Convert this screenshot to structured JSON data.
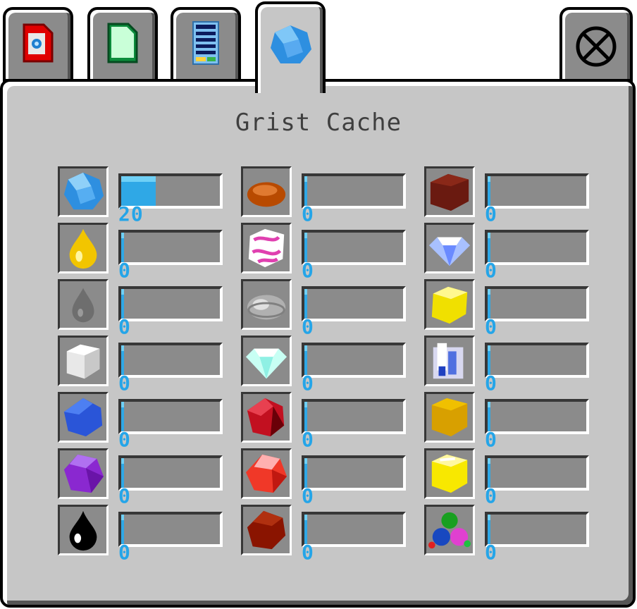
{
  "title": "Grist Cache",
  "tabs": [
    {
      "name": "captchalogue-tab",
      "icon": "red-document-icon"
    },
    {
      "name": "sylladex-tab",
      "icon": "green-document-icon"
    },
    {
      "name": "tower-tab",
      "icon": "building-icon"
    },
    {
      "name": "grist-cache-tab",
      "icon": "build-grist-icon",
      "active": true
    }
  ],
  "close_icon": "close-icon",
  "grist": [
    {
      "id": "build",
      "icon": "build-grist-icon",
      "amount": "20",
      "fill": 0.35
    },
    {
      "id": "amber",
      "icon": "amber-grist-icon",
      "amount": "0",
      "fill": 0
    },
    {
      "id": "artifact",
      "icon": "artifact-grist-icon",
      "amount": "0",
      "fill": 0
    },
    {
      "id": "chalk",
      "icon": "chalk-grist-icon",
      "amount": "0",
      "fill": 0
    },
    {
      "id": "cobalt",
      "icon": "cobalt-grist-icon",
      "amount": "0",
      "fill": 0
    },
    {
      "id": "amethyst",
      "icon": "amethyst-grist-icon",
      "amount": "0",
      "fill": 0
    },
    {
      "id": "tar",
      "icon": "tar-grist-icon",
      "amount": "0",
      "fill": 0
    },
    {
      "id": "caulk",
      "icon": "caulk-grist-icon",
      "amount": "0",
      "fill": 0
    },
    {
      "id": "marble",
      "icon": "marble-grist-icon",
      "amount": "0",
      "fill": 0
    },
    {
      "id": "shale",
      "icon": "shale-grist-icon",
      "amount": "0",
      "fill": 0
    },
    {
      "id": "diamond",
      "icon": "diamond-grist-icon",
      "amount": "0",
      "fill": 0
    },
    {
      "id": "iodine",
      "icon": "iodine-grist-icon",
      "amount": "0",
      "fill": 0
    },
    {
      "id": "ruby",
      "icon": "ruby-grist-icon",
      "amount": "0",
      "fill": 0
    },
    {
      "id": "garnet",
      "icon": "garnet-grist-icon",
      "amount": "0",
      "fill": 0
    },
    {
      "id": "rust",
      "icon": "rust-grist-icon",
      "amount": "0",
      "fill": 0
    },
    {
      "id": "mercury",
      "icon": "mercury-grist-icon",
      "amount": "0",
      "fill": 0
    },
    {
      "id": "sulfur",
      "icon": "sulfur-grist-icon",
      "amount": "0",
      "fill": 0
    },
    {
      "id": "quartz",
      "icon": "quartz-grist-icon",
      "amount": "0",
      "fill": 0
    },
    {
      "id": "uranium",
      "icon": "uranium-grist-icon",
      "amount": "0",
      "fill": 0
    },
    {
      "id": "zillium",
      "icon": "zillium-grist-icon",
      "amount": "0",
      "fill": 0
    },
    {
      "id": "gold",
      "icon": "gold-grist-icon",
      "amount": "0",
      "fill": 0
    }
  ],
  "colors": {
    "panel": "#c6c6c6",
    "slot": "#8b8b8b",
    "amount_text": "#25a5e8",
    "title_text": "#3f3f3f"
  }
}
